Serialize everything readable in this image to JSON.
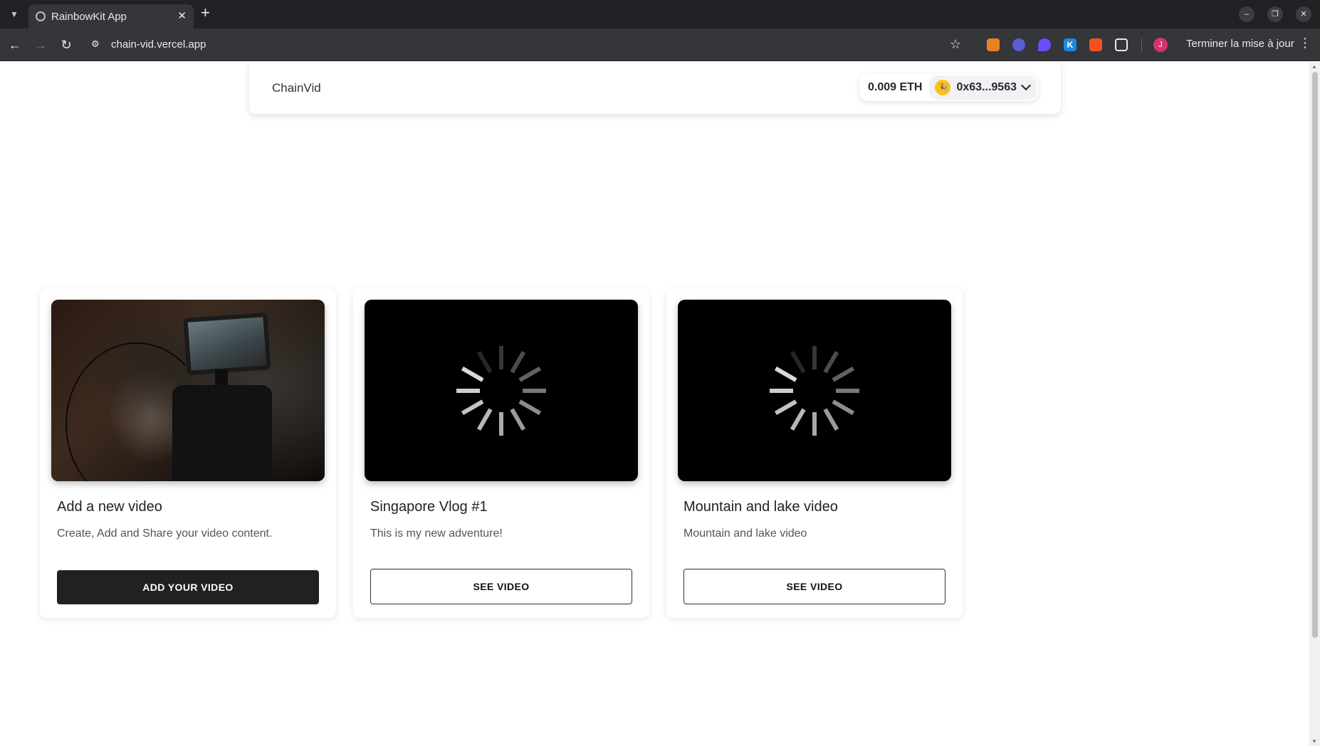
{
  "browser": {
    "tab_title": "RainbowKit App",
    "url": "chain-vid.vercel.app",
    "update_label": "Terminer la mise à jour",
    "profile_initial": "J",
    "extensions": [
      "metamask-icon",
      "puzzle-star-icon",
      "crescent-icon",
      "k-icon",
      "fox-icon",
      "extensions-icon"
    ]
  },
  "header": {
    "brand": "ChainVid",
    "balance": "0.009 ETH",
    "address": "0x63...9563",
    "avatar_emoji": "🎉"
  },
  "cards": [
    {
      "title": "Add a new video",
      "description": "Create, Add and Share your video content.",
      "button": "ADD YOUR VIDEO",
      "media": "camera-photo"
    },
    {
      "title": "Singapore Vlog #1",
      "description": "This is my new adventure!",
      "button": "SEE VIDEO",
      "media": "loading-spinner"
    },
    {
      "title": "Mountain and lake video",
      "description": "Mountain and lake video",
      "button": "SEE VIDEO",
      "media": "loading-spinner"
    }
  ],
  "colors": {
    "chrome_dark": "#202124",
    "toolbar": "#35363a",
    "button_dark": "#212121",
    "profile": "#d6336c"
  }
}
